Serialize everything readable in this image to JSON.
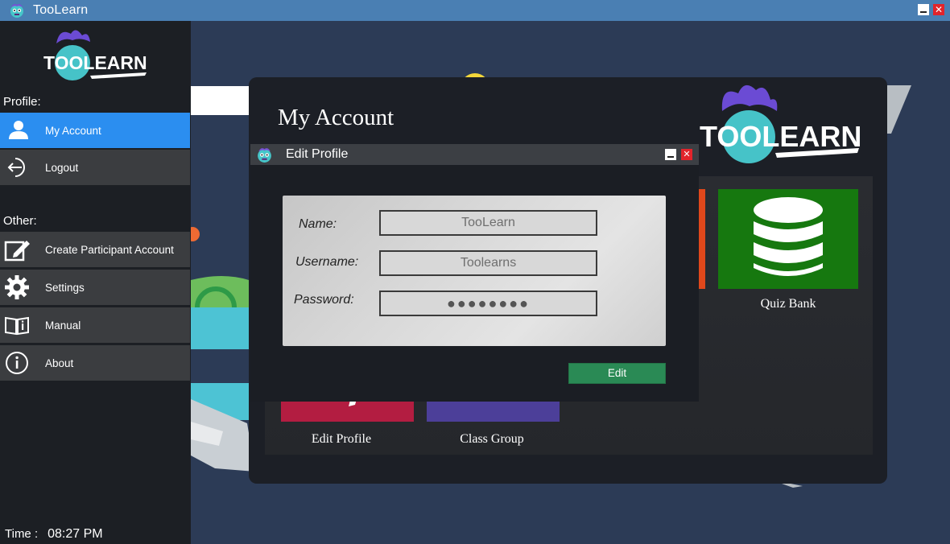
{
  "window": {
    "title": "TooLearn",
    "close_glyph": "✕"
  },
  "sidebar": {
    "logo_text": "TOOLEARN",
    "profile_label": "Profile:",
    "other_label": "Other:",
    "items": [
      {
        "label": "My Account",
        "icon": "user-icon",
        "active": true
      },
      {
        "label": "Logout",
        "icon": "logout-icon"
      },
      {
        "label": "Create Participant Account",
        "icon": "edit-icon"
      },
      {
        "label": "Settings",
        "icon": "gear-icon"
      },
      {
        "label": "Manual",
        "icon": "book-icon"
      },
      {
        "label": "About",
        "icon": "info-icon"
      }
    ],
    "time_label": "Time :",
    "time_value": "08:27 PM"
  },
  "panel": {
    "title": "My Account",
    "logo_text": "TOOLEARN",
    "tiles": [
      {
        "label": "Quiz Bank",
        "color": "#16780f",
        "icon": "database-icon"
      },
      {
        "label": "Edit Profile",
        "color": "#b31d41"
      },
      {
        "label": "Class Group",
        "color": "#4c3f99"
      }
    ]
  },
  "dialog": {
    "title": "Edit Profile",
    "close_glyph": "✕",
    "fields": {
      "name_label": "Name:",
      "name_value": "TooLearn",
      "username_label": "Username:",
      "username_value": "Toolearns",
      "password_label": "Password:",
      "password_value": "●●●●●●●●"
    },
    "edit_label": "Edit"
  },
  "colors": {
    "accent": "#2b8ef0",
    "titlebar": "#4a7fb3",
    "edit_button": "#2a8a55"
  }
}
